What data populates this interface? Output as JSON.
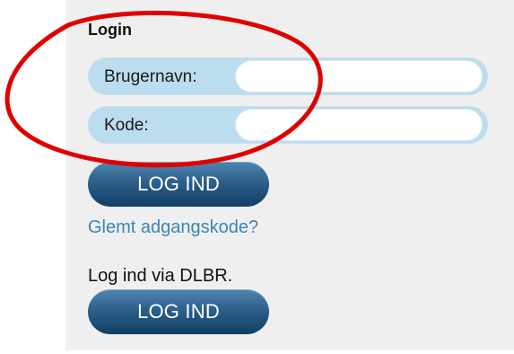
{
  "login": {
    "title": "Login",
    "username_label": "Brugernavn:",
    "password_label": "Kode:",
    "login_button": "LOG IND",
    "forgot_link": "Glemt adgangskode?",
    "dlbr_text": "Log ind via DLBR.",
    "dlbr_button": "LOG IND"
  },
  "colors": {
    "panel_background": "#efefef",
    "field_background": "#bcdcef",
    "link": "#3a86b8",
    "button": "#1f4f7c",
    "annotation": "#e00000"
  }
}
